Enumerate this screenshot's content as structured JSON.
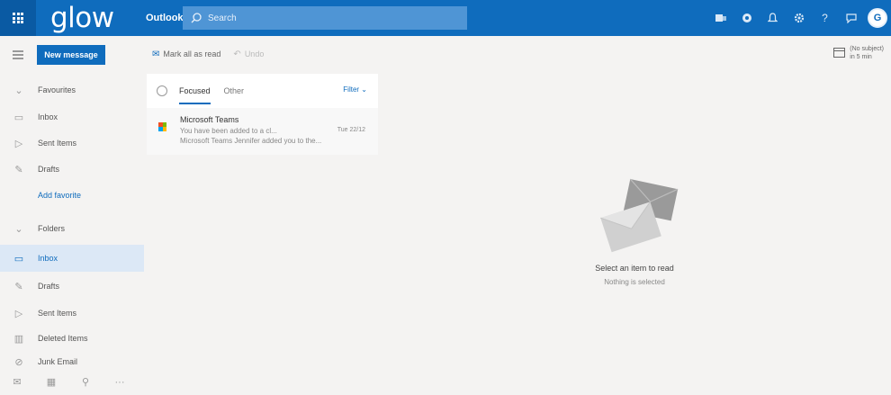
{
  "header": {
    "brand": "glow",
    "app_name": "Outlook",
    "search_placeholder": "Search",
    "avatar_initial": "G"
  },
  "colors": {
    "accent": "#0f6cbd",
    "background": "#f4f3f2",
    "selected": "#dce8f6"
  },
  "toolbar": {
    "new_message": "New message",
    "mark_all_read": "Mark all as read",
    "undo": "Undo"
  },
  "reminder": {
    "subject": "(No subject)",
    "time": "in 5 min"
  },
  "sidebar": {
    "favourites_label": "Favourites",
    "favourites": [
      {
        "label": "Inbox",
        "icon": "inbox-icon"
      },
      {
        "label": "Sent Items",
        "icon": "send-icon"
      },
      {
        "label": "Drafts",
        "icon": "pencil-icon"
      }
    ],
    "add_favourite": "Add favorite",
    "folders_label": "Folders",
    "folders": [
      {
        "label": "Inbox",
        "icon": "inbox-icon",
        "selected": true
      },
      {
        "label": "Drafts",
        "icon": "pencil-icon"
      },
      {
        "label": "Sent Items",
        "icon": "send-icon"
      },
      {
        "label": "Deleted Items",
        "icon": "trash-icon"
      },
      {
        "label": "Junk Email",
        "icon": "junk-icon"
      }
    ]
  },
  "message_list": {
    "tab_focused": "Focused",
    "tab_other": "Other",
    "filter": "Filter",
    "messages": [
      {
        "sender": "Microsoft Teams",
        "subject": "You have been added to a cl...",
        "date": "Tue 22/12",
        "preview": "Microsoft Teams Jennifer added you to the..."
      }
    ]
  },
  "reading_pane": {
    "title": "Select an item to read",
    "subtitle": "Nothing is selected"
  }
}
